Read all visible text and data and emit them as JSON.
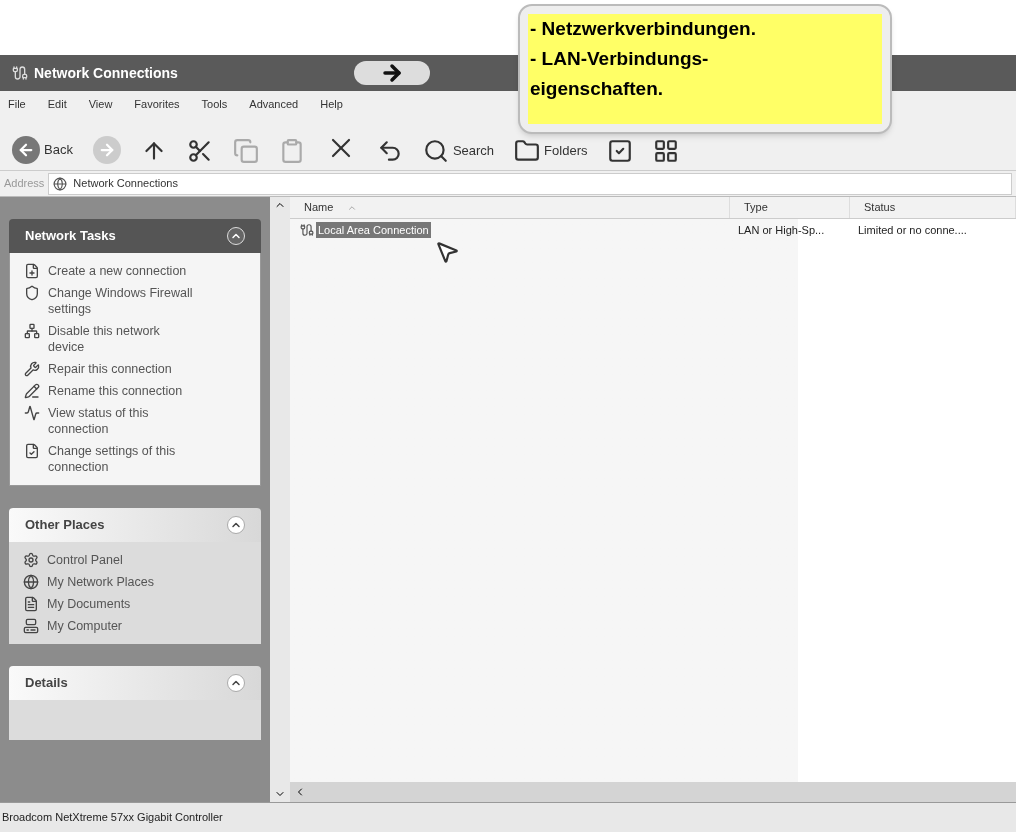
{
  "window": {
    "title": "Network Connections"
  },
  "menu": [
    "File",
    "Edit",
    "View",
    "Favorites",
    "Tools",
    "Advanced",
    "Help"
  ],
  "toolbar": [
    {
      "kind": "back",
      "label": "Back",
      "disabled": false
    },
    {
      "kind": "forward",
      "disabled": true
    },
    {
      "kind": "up",
      "disabled": false
    },
    {
      "kind": "cut",
      "disabled": false
    },
    {
      "kind": "copy",
      "disabled": true
    },
    {
      "kind": "paste",
      "disabled": true
    },
    {
      "kind": "delete",
      "disabled": false
    },
    {
      "kind": "undo",
      "disabled": false
    },
    {
      "kind": "search",
      "label": "Search",
      "disabled": false
    },
    {
      "kind": "folders",
      "label": "Folders",
      "disabled": false
    },
    {
      "kind": "check",
      "disabled": false
    },
    {
      "kind": "views",
      "disabled": false
    }
  ],
  "address": {
    "label": "Address",
    "value": "Network Connections"
  },
  "panels": [
    {
      "title": "Network Tasks",
      "kind": "primary",
      "expanded": true,
      "items": [
        {
          "kind": "new",
          "text": "Create a new connection"
        },
        {
          "kind": "firewall",
          "text": "Change Windows Firewall settings"
        },
        {
          "kind": "disable",
          "text": "Disable this network device"
        },
        {
          "kind": "repair",
          "text": "Repair this connection"
        },
        {
          "kind": "rename",
          "text": "Rename this connection"
        },
        {
          "kind": "status",
          "text": "View status of this connection"
        },
        {
          "kind": "settings",
          "text": "Change settings of this connection"
        }
      ]
    },
    {
      "title": "Other Places",
      "kind": "normal",
      "expanded": true,
      "items": [
        {
          "kind": "control",
          "text": "Control Panel"
        },
        {
          "kind": "network",
          "text": "My Network Places"
        },
        {
          "kind": "documents",
          "text": "My Documents"
        },
        {
          "kind": "computer",
          "text": "My Computer"
        }
      ]
    },
    {
      "title": "Details",
      "kind": "normal",
      "expanded": true
    }
  ],
  "table": {
    "columns": [
      {
        "label": "Name",
        "sorted": true
      },
      {
        "label": "Type",
        "sorted": false
      },
      {
        "label": "Status",
        "sorted": false
      }
    ],
    "rows": [
      {
        "name": "Local Area Connection",
        "type": "LAN or High-Sp...",
        "status": "Limited or no conne....",
        "selected": true
      }
    ]
  },
  "status_bar": "Broadcom NetXtreme 57xx Gigabit Controller",
  "callout": {
    "lines": [
      "- Netzwerkverbindungen.",
      "- LAN-Verbindungs-eigenschaften."
    ]
  }
}
